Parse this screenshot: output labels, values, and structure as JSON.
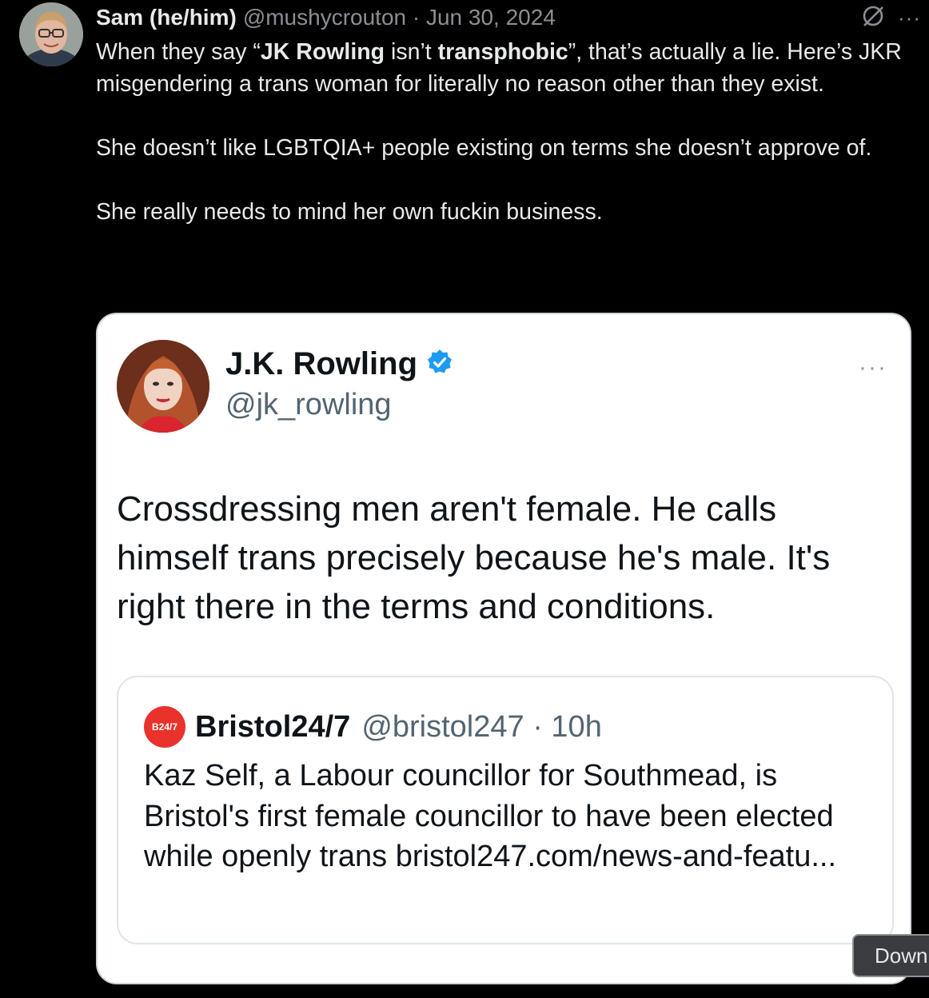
{
  "tweet": {
    "author_name": "Sam (he/him)",
    "meta": "@mushycrouton · Jun 30, 2024",
    "icons": [
      "no-sign-icon",
      "more-icon"
    ],
    "more_label": "···",
    "paragraph1": {
      "t1": "When they say “",
      "b1": "JK Rowling",
      "t2": " isn’t ",
      "b2": "transphobic",
      "t3": "”, that’s actually a lie. Here’s JKR misgendering a trans woman for literally no reason other than they exist."
    },
    "paragraph2": "She doesn’t like LGBTQIA+ people existing on terms she doesn’t approve of.",
    "paragraph3": "She really needs to mind her own fuckin business."
  },
  "embedded_screenshot": {
    "name": "J.K. Rowling",
    "handle": "@jk_rowling",
    "verified": true,
    "more_label": "···",
    "text": "Crossdressing men aren't female. He calls himself trans precisely because he's male. It's right there in the terms and conditions.",
    "quote": {
      "logo_text": "B24/7",
      "name": "Bristol24/7",
      "meta": "@bristol247 · 10h",
      "text": "Kaz Self, a Labour councillor for Southmead, is Bristol's first female councillor to have been elected while openly trans bristol247.com/news-and-featu..."
    }
  },
  "down_button": "Down",
  "colors": {
    "background": "#000000",
    "text_primary": "#e7e9ea",
    "text_secondary": "#8b8f94",
    "verified_blue": "#1d9bf0",
    "bristol_red": "#e8322b"
  }
}
